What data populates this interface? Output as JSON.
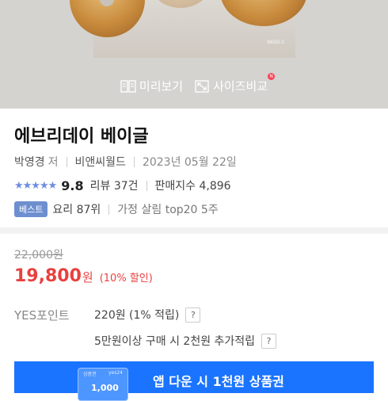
{
  "hero": {
    "watermark": "BAGELS",
    "preview_label": "미리보기",
    "size_compare_label": "사이즈비교",
    "new_badge": "N",
    "preview_icon": "book-open-icon",
    "size_icon": "resize-arrows-icon"
  },
  "product": {
    "title": "에브리데이 베이글",
    "author": "박영경",
    "author_suffix": "저",
    "publisher": "비앤씨월드",
    "date": "2023년 05월 22일",
    "stars": "★★★★★",
    "score": "9.8",
    "review_label": "리뷰 37건",
    "sales_index": "판매지수 4,896",
    "best_badge": "베스트",
    "rank_primary": "요리 87위",
    "rank_secondary": "가정 살림 top20 5주"
  },
  "price": {
    "original": "22,000원",
    "sale_amount": "19,800",
    "sale_unit": "원",
    "discount": "(10% 할인)"
  },
  "points": {
    "label": "YES포인트",
    "row1": "220원 (1% 적립)",
    "row2": "5만원이상 구매 시 2천원 추가적립",
    "help": "?"
  },
  "banner": {
    "coupon_left": "상품권",
    "coupon_right": "yes24",
    "coupon_amount": "1,000",
    "text": "앱 다운 시 1천원 상품권"
  },
  "colors": {
    "accent_red": "#e8413f",
    "star_blue": "#6f8ee0",
    "banner_blue": "#1a74ff",
    "badge_blue": "#6e8fcf"
  }
}
